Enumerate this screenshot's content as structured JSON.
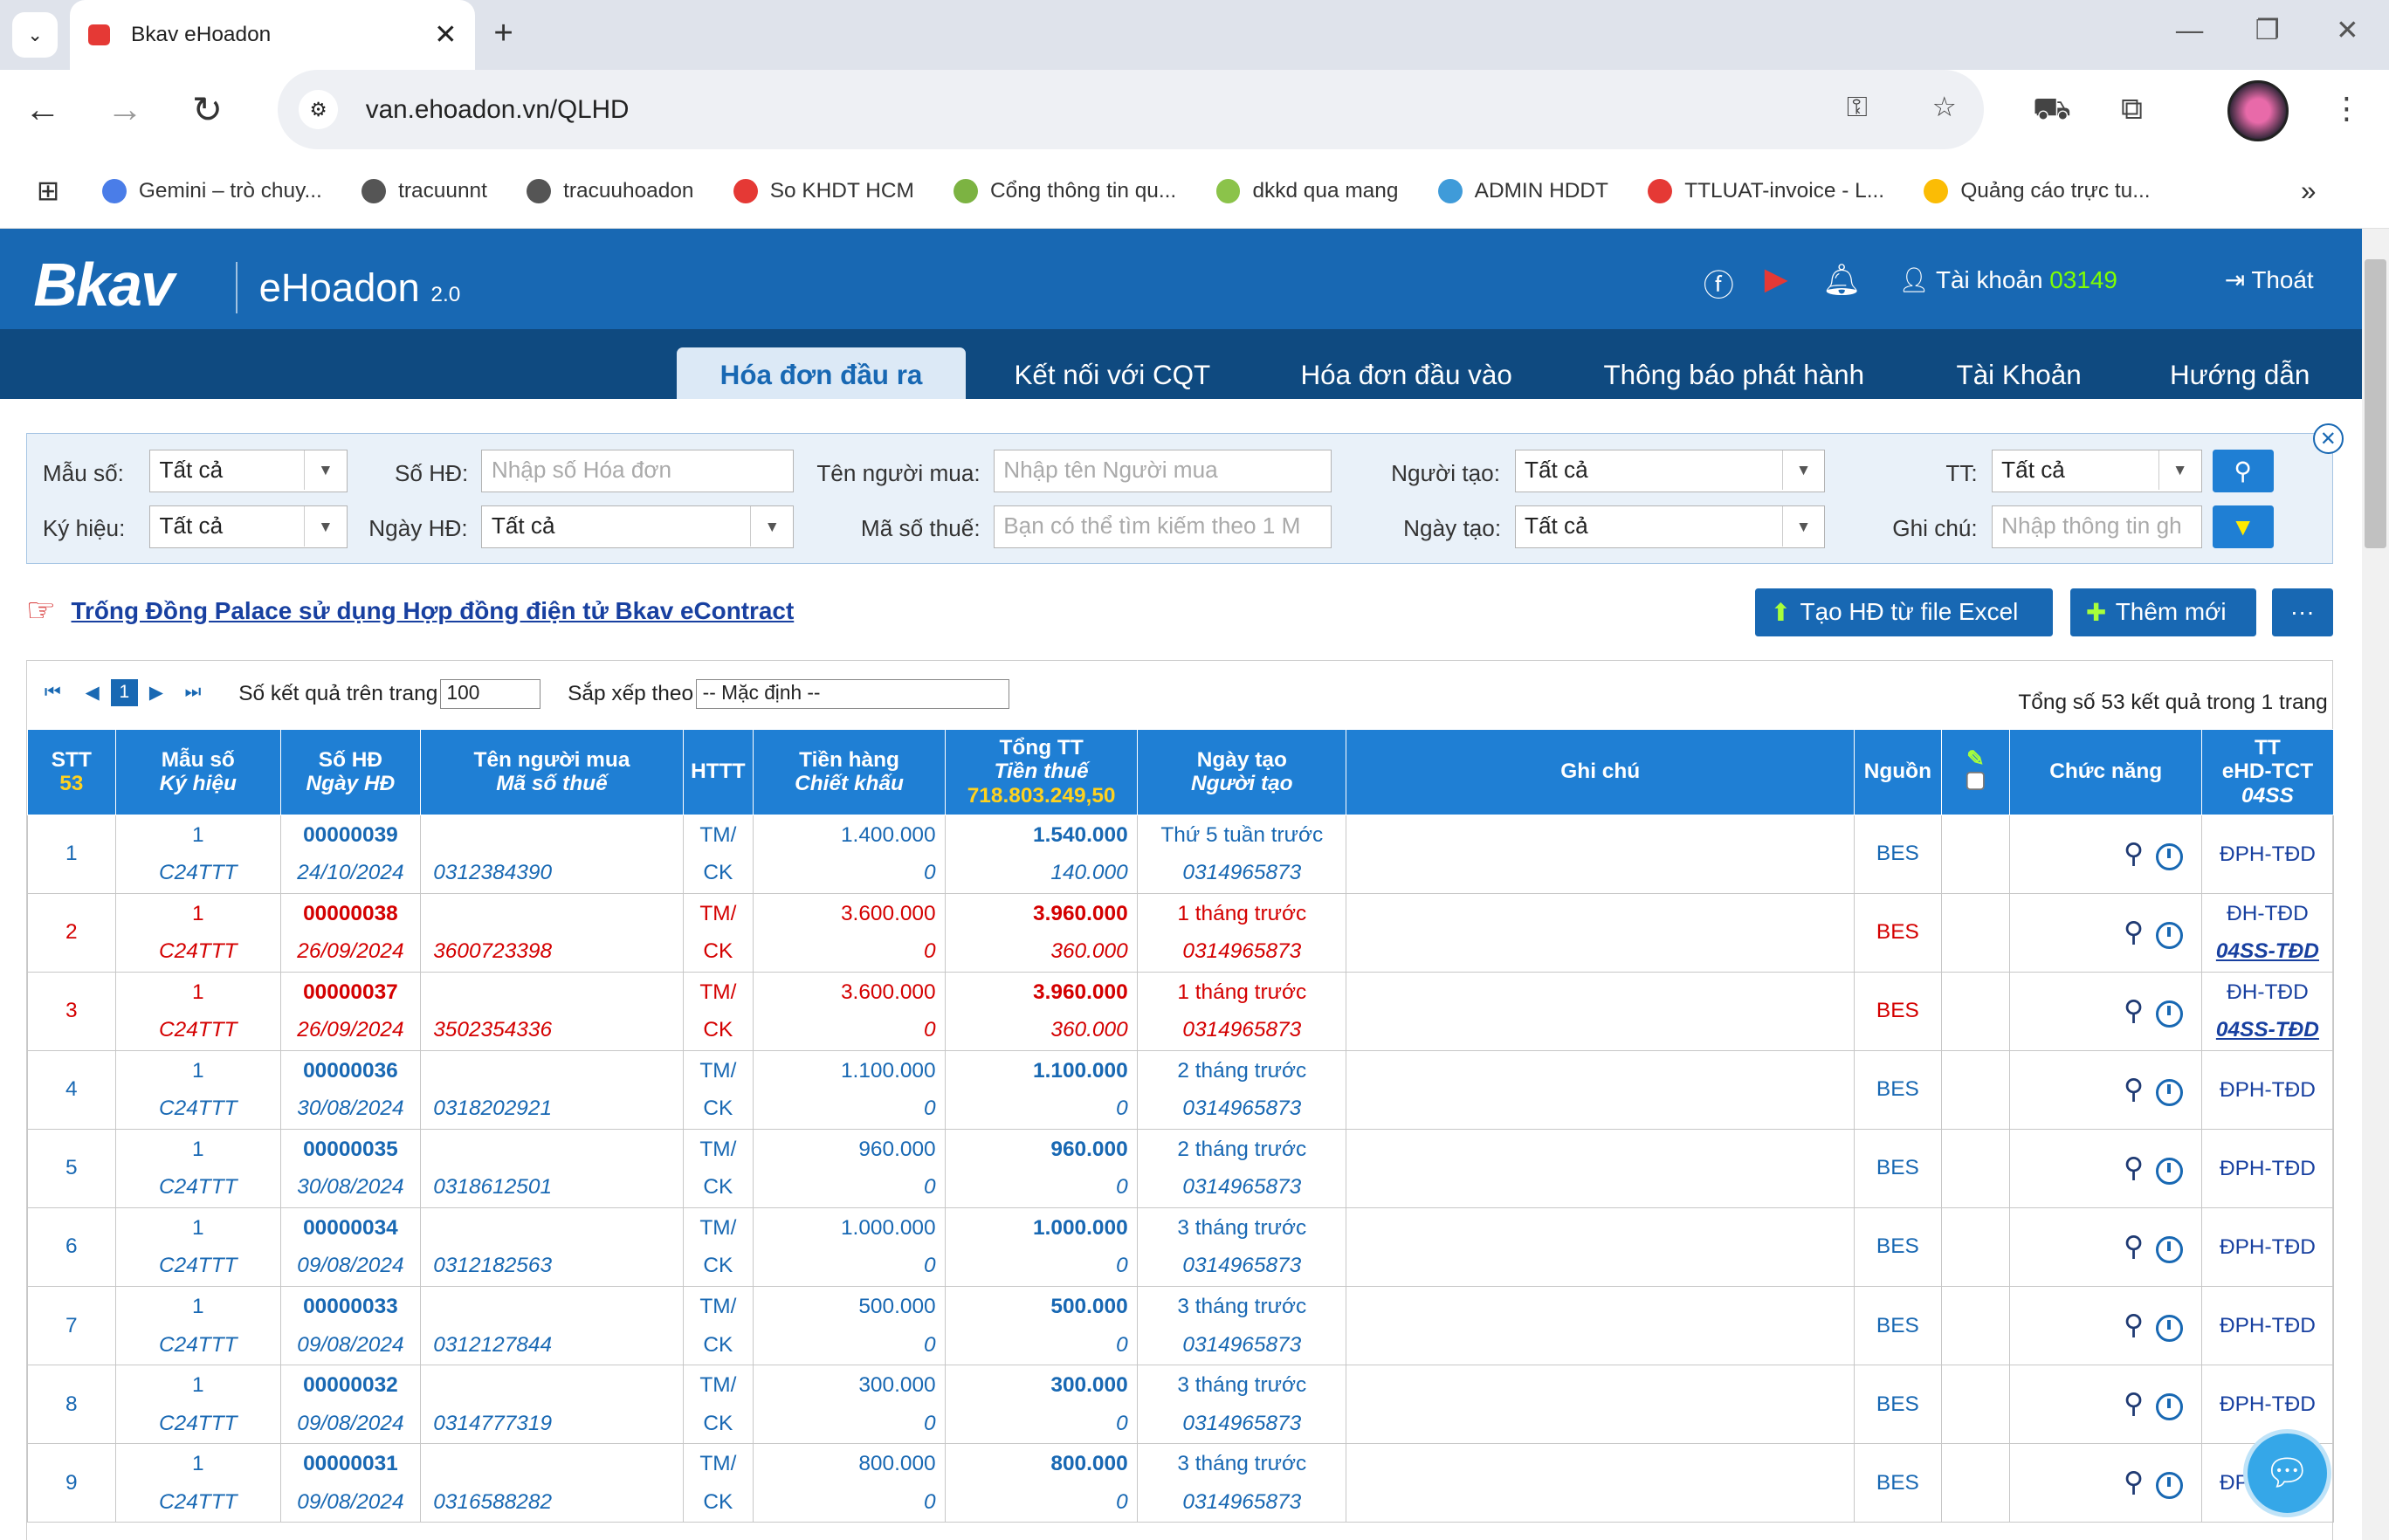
{
  "browser": {
    "tab_title": "Bkav eHoadon",
    "url": "van.ehoadon.vn/QLHD",
    "bookmarks": [
      {
        "label": "Gemini – trò chuy...",
        "color": "#4a7de8"
      },
      {
        "label": "tracuunnt",
        "color": "#555555"
      },
      {
        "label": "tracuuhoadon",
        "color": "#555555"
      },
      {
        "label": "So KHDT HCM",
        "color": "#e53935"
      },
      {
        "label": "Cổng thông tin qu...",
        "color": "#7cb342"
      },
      {
        "label": "dkkd qua mang",
        "color": "#8bc34a"
      },
      {
        "label": "ADMIN HDDT",
        "color": "#3f9bd9"
      },
      {
        "label": "TTLUAT-invoice - L...",
        "color": "#e53935"
      },
      {
        "label": "Quảng cáo trực tu...",
        "color": "#fbbc05"
      }
    ]
  },
  "app": {
    "logo": "Bkav",
    "logo_sub": "eHoadon",
    "logo_ver": "2.0",
    "account_label": "Tài khoản",
    "account_number": "03149",
    "logout": "Thoát",
    "nav": [
      "Hóa đơn đầu ra",
      "Kết nối với CQT",
      "Hóa đơn đầu vào",
      "Thông báo phát hành",
      "Tài Khoản",
      "Hướng dẫn"
    ]
  },
  "filters": {
    "mau_so_label": "Mẫu số:",
    "mau_so_value": "Tất cả",
    "ky_hieu_label": "Ký hiệu:",
    "ky_hieu_value": "Tất cả",
    "so_hd_label": "Số HĐ:",
    "so_hd_placeholder": "Nhập số Hóa đơn",
    "ngay_hd_label": "Ngày HĐ:",
    "ngay_hd_value": "Tất cả",
    "ten_nguoi_mua_label": "Tên người mua:",
    "ten_nguoi_mua_placeholder": "Nhập tên Người mua",
    "mst_label": "Mã số thuế:",
    "mst_placeholder": "Bạn có thể tìm kiếm theo 1 M",
    "nguoi_tao_label": "Người tạo:",
    "nguoi_tao_value": "Tất cả",
    "ngay_tao_label": "Ngày tạo:",
    "ngay_tao_value": "Tất cả",
    "tt_label": "TT:",
    "tt_value": "Tất cả",
    "ghi_chu_label": "Ghi chú:",
    "ghi_chu_placeholder": "Nhập thông tin gh"
  },
  "notice": "Trống Đồng Palace sử dụng Hợp đồng điện tử Bkav eContract",
  "actions": {
    "excel": "Tạo HĐ từ file Excel",
    "add": "Thêm mới",
    "more": "···"
  },
  "pager": {
    "current_page": "1",
    "per_page_label": "Số kết quả trên trang",
    "per_page_value": "100",
    "sort_label": "Sắp xếp theo",
    "sort_value": "-- Mặc định --",
    "summary": "Tổng số 53 kết quả trong 1 trang"
  },
  "table": {
    "headers": {
      "stt": "STT",
      "stt_count": "53",
      "mau_so": "Mẫu số",
      "ky_hieu": "Ký hiệu",
      "so_hd": "Số HĐ",
      "ngay_hd": "Ngày HĐ",
      "ten_nguoi_mua": "Tên người mua",
      "mst": "Mã số thuế",
      "httt": "HTTT",
      "tien_hang": "Tiền hàng",
      "chiet_khau": "Chiết khấu",
      "tong_tt": "Tổng TT",
      "tien_thue": "Tiền thuế",
      "tong_sum": "718.803.249,50",
      "ngay_tao": "Ngày tạo",
      "nguoi_tao": "Người tạo",
      "ghi_chu": "Ghi chú",
      "nguon": "Nguồn",
      "chuc_nang": "Chức năng",
      "tt1": "TT",
      "tt2": "eHD-TCT",
      "tt3": "04SS"
    },
    "rows": [
      {
        "stt": "1",
        "mau": "1",
        "kh": "C24TTT",
        "so": "00000039",
        "ngay": "24/10/2024",
        "mst": "0312384390",
        "httt1": "TM/",
        "httt2": "CK",
        "tien": "1.400.000",
        "ck": "0",
        "tong": "1.540.000",
        "thue": "140.000",
        "ntao": "Thứ 5 tuần trước",
        "nguoi": "0314965873",
        "nguon": "BES",
        "tt1": "ĐPH-TĐD",
        "tt2": "",
        "red": false
      },
      {
        "stt": "2",
        "mau": "1",
        "kh": "C24TTT",
        "so": "00000038",
        "ngay": "26/09/2024",
        "mst": "3600723398",
        "httt1": "TM/",
        "httt2": "CK",
        "tien": "3.600.000",
        "ck": "0",
        "tong": "3.960.000",
        "thue": "360.000",
        "ntao": "1 tháng trước",
        "nguoi": "0314965873",
        "nguon": "BES",
        "tt1": "ĐH-TĐD",
        "tt2": "04SS-TĐD",
        "red": true
      },
      {
        "stt": "3",
        "mau": "1",
        "kh": "C24TTT",
        "so": "00000037",
        "ngay": "26/09/2024",
        "mst": "3502354336",
        "httt1": "TM/",
        "httt2": "CK",
        "tien": "3.600.000",
        "ck": "0",
        "tong": "3.960.000",
        "thue": "360.000",
        "ntao": "1 tháng trước",
        "nguoi": "0314965873",
        "nguon": "BES",
        "tt1": "ĐH-TĐD",
        "tt2": "04SS-TĐD",
        "red": true
      },
      {
        "stt": "4",
        "mau": "1",
        "kh": "C24TTT",
        "so": "00000036",
        "ngay": "30/08/2024",
        "mst": "0318202921",
        "httt1": "TM/",
        "httt2": "CK",
        "tien": "1.100.000",
        "ck": "0",
        "tong": "1.100.000",
        "thue": "0",
        "ntao": "2 tháng trước",
        "nguoi": "0314965873",
        "nguon": "BES",
        "tt1": "ĐPH-TĐD",
        "tt2": "",
        "red": false
      },
      {
        "stt": "5",
        "mau": "1",
        "kh": "C24TTT",
        "so": "00000035",
        "ngay": "30/08/2024",
        "mst": "0318612501",
        "httt1": "TM/",
        "httt2": "CK",
        "tien": "960.000",
        "ck": "0",
        "tong": "960.000",
        "thue": "0",
        "ntao": "2 tháng trước",
        "nguoi": "0314965873",
        "nguon": "BES",
        "tt1": "ĐPH-TĐD",
        "tt2": "",
        "red": false
      },
      {
        "stt": "6",
        "mau": "1",
        "kh": "C24TTT",
        "so": "00000034",
        "ngay": "09/08/2024",
        "mst": "0312182563",
        "httt1": "TM/",
        "httt2": "CK",
        "tien": "1.000.000",
        "ck": "0",
        "tong": "1.000.000",
        "thue": "0",
        "ntao": "3 tháng trước",
        "nguoi": "0314965873",
        "nguon": "BES",
        "tt1": "ĐPH-TĐD",
        "tt2": "",
        "red": false
      },
      {
        "stt": "7",
        "mau": "1",
        "kh": "C24TTT",
        "so": "00000033",
        "ngay": "09/08/2024",
        "mst": "0312127844",
        "httt1": "TM/",
        "httt2": "CK",
        "tien": "500.000",
        "ck": "0",
        "tong": "500.000",
        "thue": "0",
        "ntao": "3 tháng trước",
        "nguoi": "0314965873",
        "nguon": "BES",
        "tt1": "ĐPH-TĐD",
        "tt2": "",
        "red": false
      },
      {
        "stt": "8",
        "mau": "1",
        "kh": "C24TTT",
        "so": "00000032",
        "ngay": "09/08/2024",
        "mst": "0314777319",
        "httt1": "TM/",
        "httt2": "CK",
        "tien": "300.000",
        "ck": "0",
        "tong": "300.000",
        "thue": "0",
        "ntao": "3 tháng trước",
        "nguoi": "0314965873",
        "nguon": "BES",
        "tt1": "ĐPH-TĐD",
        "tt2": "",
        "red": false
      },
      {
        "stt": "9",
        "mau": "1",
        "kh": "C24TTT",
        "so": "00000031",
        "ngay": "09/08/2024",
        "mst": "0316588282",
        "httt1": "TM/",
        "httt2": "CK",
        "tien": "800.000",
        "ck": "0",
        "tong": "800.000",
        "thue": "0",
        "ntao": "3 tháng trước",
        "nguoi": "0314965873",
        "nguon": "BES",
        "tt1": "ĐPH-TĐD",
        "tt2": "",
        "red": false
      }
    ]
  },
  "colors": {
    "header_blue": "#1868b3",
    "nav_dark": "#0f4a80",
    "th_blue": "#1f7fd4",
    "error_red": "#d40000"
  }
}
